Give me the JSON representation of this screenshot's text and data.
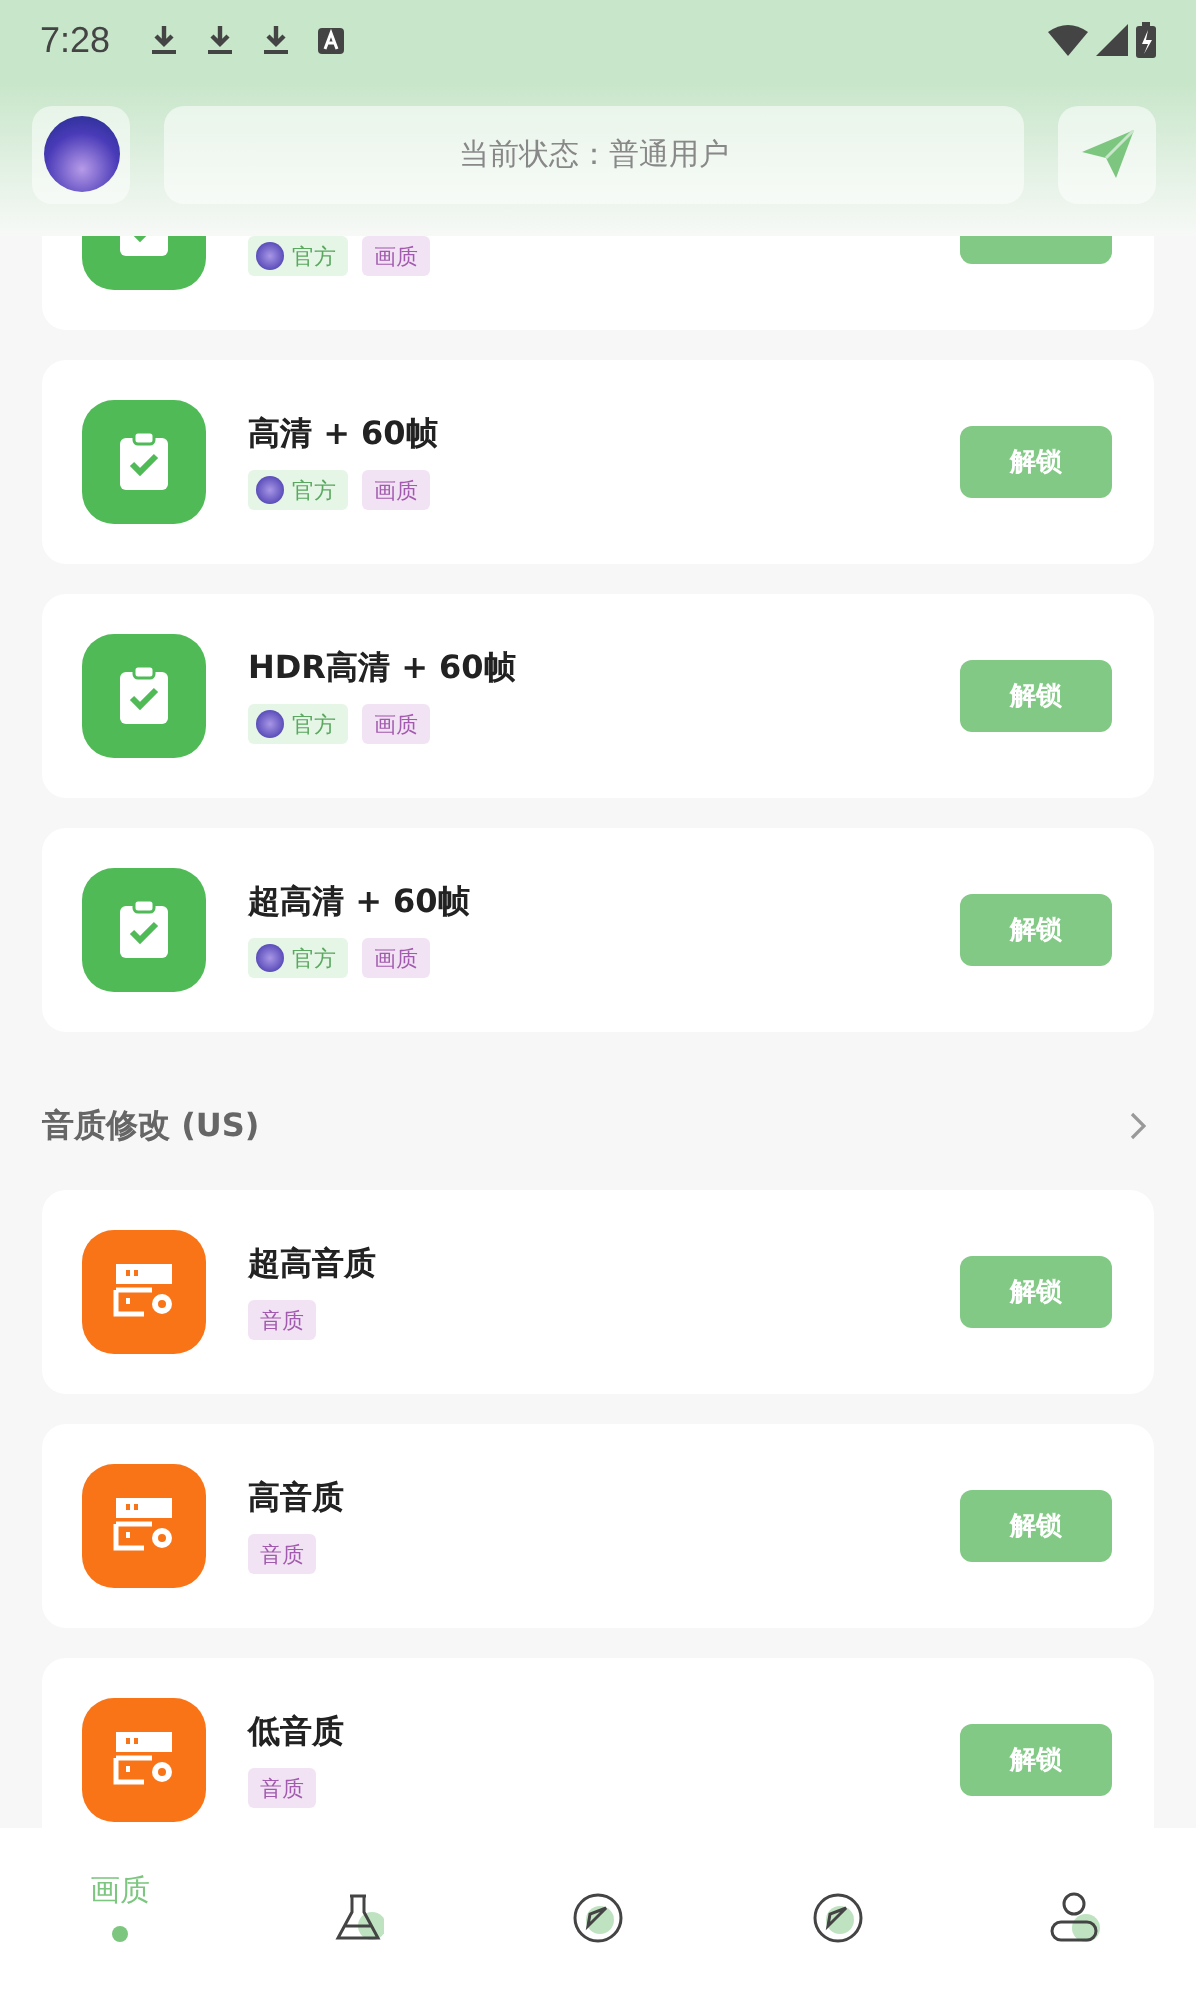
{
  "status_bar": {
    "time": "7:28"
  },
  "header": {
    "status_text": "当前状态：普通用户"
  },
  "video_cards": [
    {
      "tags": [
        {
          "kind": "official",
          "label": "官方"
        },
        {
          "kind": "category",
          "label": "画质"
        }
      ]
    },
    {
      "title": "高清 + 60帧",
      "tags": [
        {
          "kind": "official",
          "label": "官方"
        },
        {
          "kind": "category",
          "label": "画质"
        }
      ],
      "button": "解锁"
    },
    {
      "title": "HDR高清 + 60帧",
      "tags": [
        {
          "kind": "official",
          "label": "官方"
        },
        {
          "kind": "category",
          "label": "画质"
        }
      ],
      "button": "解锁"
    },
    {
      "title": "超高清 + 60帧",
      "tags": [
        {
          "kind": "official",
          "label": "官方"
        },
        {
          "kind": "category",
          "label": "画质"
        }
      ],
      "button": "解锁"
    }
  ],
  "audio_section": {
    "title": "音质修改 (US)",
    "cards": [
      {
        "title": "超高音质",
        "tags": [
          {
            "kind": "category",
            "label": "音质"
          }
        ],
        "button": "解锁"
      },
      {
        "title": "高音质",
        "tags": [
          {
            "kind": "category",
            "label": "音质"
          }
        ],
        "button": "解锁"
      },
      {
        "title": "低音质",
        "tags": [
          {
            "kind": "category",
            "label": "音质"
          }
        ],
        "button": "解锁"
      }
    ]
  },
  "bottom_nav": [
    {
      "kind": "label",
      "label": "画质",
      "selected": true
    },
    {
      "kind": "flask",
      "selected": false
    },
    {
      "kind": "compass",
      "selected": false
    },
    {
      "kind": "compass",
      "selected": false
    },
    {
      "kind": "person",
      "selected": false
    }
  ]
}
